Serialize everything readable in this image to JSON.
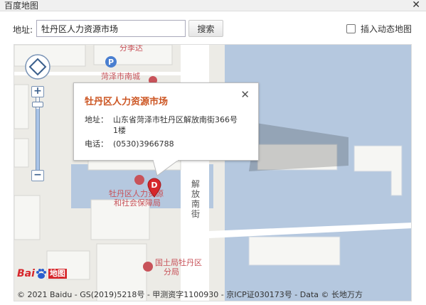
{
  "window": {
    "title": "百度地图"
  },
  "toolbar": {
    "address_label": "地址:",
    "address_value": "牡丹区人力资源市场",
    "search_label": "搜索",
    "dynamic_map_label": "插入动态地图",
    "dynamic_map_checked": false
  },
  "map": {
    "labels": {
      "parking_top": "分季达",
      "poi_nancheng": "菏泽市南城",
      "poi_hr_line1": "牡丹区人力资源",
      "poi_hr_line2": "和社会保障局",
      "poi_land_line1": "国土局牡丹区",
      "poi_land_line2": "分局",
      "street_name": "解放南街"
    },
    "marker_letter": "D",
    "popup": {
      "title": "牡丹区人力资源市场",
      "address_key": "地址：",
      "address_value": "山东省菏泽市牡丹区解放南街366号1楼",
      "phone_key": "电话：",
      "phone_value": "(0530)3966788"
    },
    "logo": {
      "text": "Bai",
      "suffix": "地图"
    },
    "copyright": "© 2021 Baidu - GS(2019)5218号 - 甲测资字1100930 - 京ICP证030173号 - Data © 长地万方",
    "zoom_level_fraction": 0.06
  },
  "colors": {
    "water": "#b5c8df",
    "block": "#ecebe6",
    "road": "#ffffff",
    "poi_text": "#c8535a",
    "popup_title": "#cc5522",
    "marker": "#d6262b"
  }
}
